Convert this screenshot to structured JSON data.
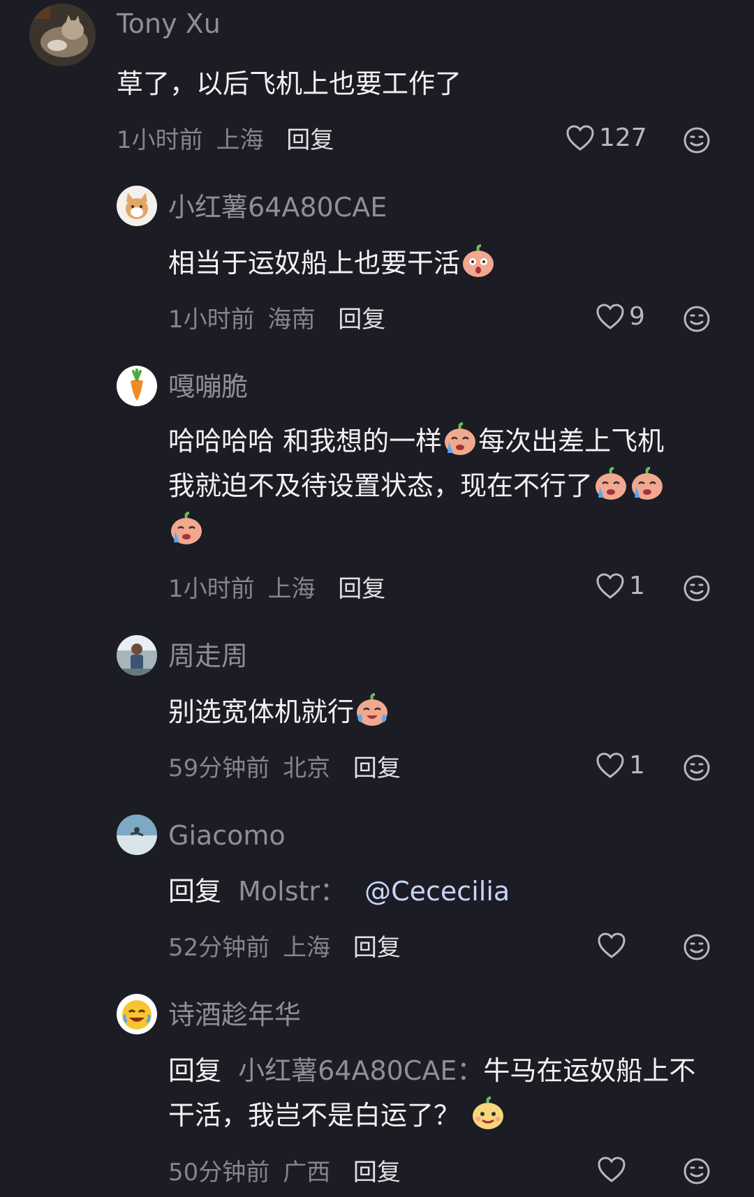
{
  "comments": [
    {
      "username": "Tony Xu",
      "content": "草了，以后飞机上也要工作了",
      "time": "1小时前",
      "location": "上海",
      "reply_label": "回复",
      "likes": "127"
    },
    {
      "username": "小红薯64A80CAE",
      "content": "相当于运奴船上也要干活",
      "time": "1小时前",
      "location": "海南",
      "reply_label": "回复",
      "likes": "9"
    },
    {
      "username": "嘎嘣脆",
      "content_line1": "哈哈哈哈 和我想的一样",
      "content_line1b": "每次出差上飞机",
      "content_line2": "我就迫不及待设置状态，现在不行了",
      "time": "1小时前",
      "location": "上海",
      "reply_label": "回复",
      "likes": "1"
    },
    {
      "username": "周走周",
      "content": "别选宽体机就行",
      "time": "59分钟前",
      "location": "北京",
      "reply_label": "回复",
      "likes": "1"
    },
    {
      "username": "Giacomo",
      "reply_prefix": "回复",
      "reply_to": "Molstr：",
      "mention": "@Cececilia",
      "time": "52分钟前",
      "location": "上海",
      "reply_label": "回复",
      "likes": ""
    },
    {
      "username": "诗酒趁年华",
      "reply_prefix": "回复",
      "reply_to": "小红薯64A80CAE：",
      "content_line1": "牛马在运奴船上不",
      "content_line2": "干活，我岂不是白运了？",
      "time": "50分钟前",
      "location": "广西",
      "reply_label": "回复",
      "likes": ""
    }
  ],
  "icons": {
    "like": "heart-outline-icon",
    "reaction": "smiley-face-icon"
  },
  "colors": {
    "background": "#1c1c24",
    "username": "#8e8e96",
    "text": "#f2f2f2",
    "meta": "#85858d",
    "mention": "#c9d4ff"
  }
}
